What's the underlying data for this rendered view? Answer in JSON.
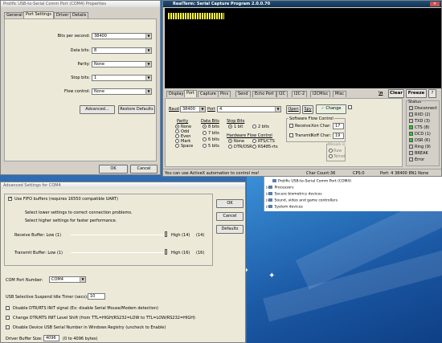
{
  "props": {
    "title": "Prolific USB-to-Serial Comm Port (COM4) Properties",
    "tabs": [
      "General",
      "Port Settings",
      "Driver",
      "Details"
    ],
    "fields": [
      {
        "label": "Bits per second:",
        "value": "38400"
      },
      {
        "label": "Data bits:",
        "value": "8"
      },
      {
        "label": "Parity:",
        "value": "None"
      },
      {
        "label": "Stop bits:",
        "value": "1"
      },
      {
        "label": "Flow control:",
        "value": "None"
      }
    ],
    "advanced": "Advanced...",
    "restore": "Restore Defaults",
    "ok": "OK",
    "cancel": "Cancel"
  },
  "rt": {
    "title": "RealTerm: Serial Capture Program 2.0.0.70",
    "tabs": [
      "Display",
      "Port",
      "Capture",
      "Pins",
      "Send",
      "Echo Port",
      "I2C",
      "I2C-2",
      "I2CMisc",
      "Misc"
    ],
    "nl": "\\n",
    "clear": "Clear",
    "freeze": "Freeze",
    "help": "?",
    "baud_label": "Baud",
    "baud": "38400",
    "port_label": "Port",
    "port": "4",
    "open": "Open",
    "spy": "Spy",
    "change": "Change",
    "parity_title": "Parity",
    "parity": [
      "None",
      "Odd",
      "Even",
      "Mark",
      "Space"
    ],
    "databits_title": "Data Bits",
    "databits": [
      "8 bits",
      "7 bits",
      "6 bits",
      "5 bits"
    ],
    "stopbits_title": "Stop Bits",
    "stopbits": [
      "1 bit",
      "2 bits"
    ],
    "hwflow_title": "Hardware Flow Control",
    "hwflow": [
      "None",
      "RTS/CTS",
      "DTR/DSR",
      "RS485-rts"
    ],
    "swflow_title": "Software Flow Control",
    "receive": "Receive",
    "xon_label": "Xon Char:",
    "xon": "17",
    "transmit": "Transmit",
    "xoff_label": "Xoff Char:",
    "xoff": "19",
    "winsock_title": "Winsock is:",
    "winsock": [
      "Raw",
      "Telnet"
    ],
    "status_title": "Status",
    "status": [
      "Disconnect",
      "RXD (2)",
      "TXD (3)",
      "CTS (8)",
      "DCD (1)",
      "DSR (6)",
      "Ring (9)",
      "BREAK",
      "Error"
    ],
    "statusbar": [
      "You can use ActiveX automation to control me!",
      "Char Count:36",
      "CPS:0",
      "Port: 4 38400 8N1 None"
    ]
  },
  "adv": {
    "title": "Advanced Settings for COM4",
    "fifo": "Use FIFO buffers (requires 16550 compatible UART)",
    "hint1": "Select lower settings to correct connection problems.",
    "hint2": "Select higher settings for faster performance.",
    "rx_label": "Receive Buffer:  Low (1)",
    "rx_high": "High (14)",
    "rx_val": "(14)",
    "tx_label": "Transmit Buffer:  Low (1)",
    "tx_high": "High (16)",
    "tx_val": "(16)",
    "ok": "OK",
    "cancel": "Cancel",
    "defaults": "Defaults",
    "com_label": "COM Port Number:",
    "com": "COM4",
    "timer_label": "USB Selective Suspend Idle Timer (secs):",
    "timer": "10",
    "opts": [
      "Disable DTR/RTS INIT signal (Ex: disable Serial Mouse/Modem detection)",
      "Change DTR/RTS INIT Level Shift (from TTL=HIGH/RS232=LOW to TTL=LOW/RS232=HIGH)",
      "Disable Device USB Serial Number in Windows Registry (uncheck to Enable)"
    ],
    "drvbuf_label": "Driver Buffer Size:",
    "drvbuf": "4096",
    "drvbuf_range": "(0 to 4096 bytes)"
  },
  "dm": {
    "items": [
      "Prolific USB-to-Serial Comm Port (COM4)",
      "Processors",
      "Secure biometrics devices",
      "Sound, video and game controllers",
      "System devices"
    ]
  }
}
